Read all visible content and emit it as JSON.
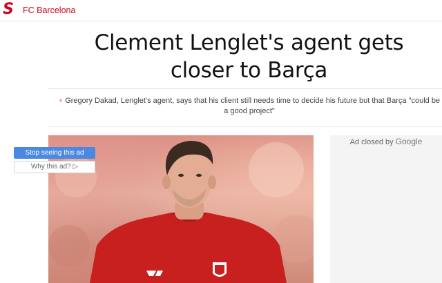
{
  "header": {
    "logo_letter": "S",
    "section_label": "FC Barcelona"
  },
  "article": {
    "title": "Clement Lenglet's agent gets closer to Barça",
    "summary_bullet": "∘",
    "summary": "Gregory Dakad, Lenglet's agent, says that his client still needs time to decide his future but that Barça \"could be a good project\""
  },
  "ad": {
    "closed_by": "Ad closed by",
    "google": "Google",
    "stop_button": "Stop seeing this ad",
    "why_button": "Why this ad? ▷"
  },
  "colors": {
    "brand_red": "#d0021b",
    "ad_blue": "#4a88e2",
    "jersey_red": "#c8201f"
  }
}
